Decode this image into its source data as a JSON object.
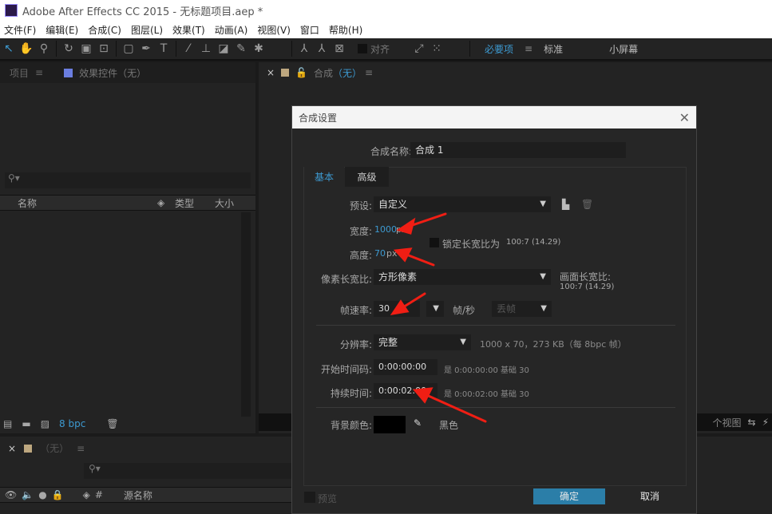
{
  "window": {
    "title": "Adobe After Effects CC 2015 - 无标题项目.aep *",
    "logo": "Ae"
  },
  "menu": [
    "文件(F)",
    "编辑(E)",
    "合成(C)",
    "图层(L)",
    "效果(T)",
    "动画(A)",
    "视图(V)",
    "窗口",
    "帮助(H)"
  ],
  "toolbar": {
    "align_label": "对齐",
    "workspaces": [
      "必要项",
      "标准",
      "小屏幕"
    ]
  },
  "project_panel": {
    "tab": "项目",
    "effects_tab": "效果控件（无）",
    "columns": [
      "名称",
      "类型",
      "大小"
    ],
    "bpc": "8 bpc"
  },
  "comp_panel": {
    "tab": "合成",
    "tab_suffix": "（无）",
    "view_label": "个视图"
  },
  "timeline": {
    "tab": "（无）",
    "columns": [
      "#",
      "源名称"
    ]
  },
  "dialog": {
    "title": "合成设置",
    "name_label": "合成名称:",
    "name_value": "合成 1",
    "tabs": [
      "基本",
      "高级"
    ],
    "preset_label": "预设:",
    "preset_value": "自定义",
    "width_label": "宽度:",
    "width_value": "1000",
    "unit": "px",
    "lock_label": "锁定长宽比为",
    "lock_ratio": "100:7 (14.29)",
    "height_label": "高度:",
    "height_value": "70",
    "par_label": "像素长宽比:",
    "par_value": "方形像素",
    "frame_ar_label": "画面长宽比:",
    "frame_ar_value": "100:7 (14.29)",
    "fps_label": "帧速率:",
    "fps_value": "30",
    "fps_unit": "帧/秒",
    "drop_frame": "丢帧",
    "res_label": "分辨率:",
    "res_value": "完整",
    "res_info": "1000 x 70，273 KB（每 8bpc 帧）",
    "start_label": "开始时间码:",
    "start_value": "0:00:00:00",
    "start_info": "是 0:00:00:00  基础 30",
    "dur_label": "持续时间:",
    "dur_value": "0:00:02:00",
    "dur_info": "是 0:00:02:00  基础 30",
    "bg_label": "背景颜色:",
    "bg_name": "黑色",
    "bg_color": "#000000",
    "preview_label": "预览",
    "ok": "确定",
    "cancel": "取消"
  },
  "accent": "#3d9ad1"
}
